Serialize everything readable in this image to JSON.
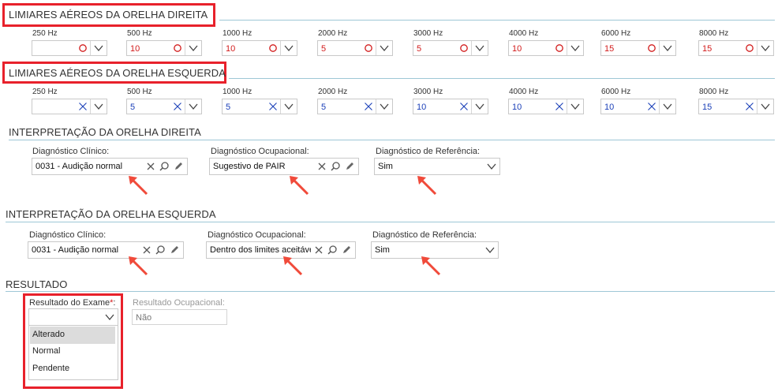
{
  "right_ear": {
    "title": "LIMIARES AÉREOS DA ORELHA DIREITA",
    "frequencies": [
      "250 Hz",
      "500 Hz",
      "1000 Hz",
      "2000 Hz",
      "3000 Hz",
      "4000 Hz",
      "6000 Hz",
      "8000 Hz"
    ],
    "values": [
      "",
      "10",
      "10",
      "5",
      "5",
      "10",
      "15",
      "15"
    ],
    "marker_icon": "circle-icon",
    "value_color": "#d21b1b"
  },
  "left_ear": {
    "title": "LIMIARES AÉREOS DA ORELHA ESQUERDA",
    "frequencies": [
      "250 Hz",
      "500 Hz",
      "1000 Hz",
      "2000 Hz",
      "3000 Hz",
      "4000 Hz",
      "6000 Hz",
      "8000 Hz"
    ],
    "values": [
      "",
      "5",
      "5",
      "5",
      "10",
      "10",
      "10",
      "15"
    ],
    "marker_icon": "x-mark-icon",
    "value_color": "#1a3fb8"
  },
  "interp_right": {
    "title": "INTERPRETAÇÃO DA ORELHA DIREITA",
    "clinical_label": "Diagnóstico Clínico:",
    "clinical_value": "0031 - Audição normal",
    "occupational_label": "Diagnóstico Ocupacional:",
    "occupational_value": "Sugestivo de PAIR",
    "reference_label": "Diagnóstico de Referência:",
    "reference_value": "Sim"
  },
  "interp_left": {
    "title": "INTERPRETAÇÃO DA ORELHA ESQUERDA",
    "clinical_label": "Diagnóstico Clínico:",
    "clinical_value": "0031 - Audição normal",
    "occupational_label": "Diagnóstico Ocupacional:",
    "occupational_value": "Dentro dos limites aceitáveis",
    "reference_label": "Diagnóstico de Referência:",
    "reference_value": "Sim"
  },
  "result": {
    "title": "RESULTADO",
    "exam_label": "Resultado do Exame",
    "required_mark": "*",
    "exam_colon": ":",
    "exam_value": "",
    "options": [
      "Alterado",
      "Normal",
      "Pendente"
    ],
    "occupational_label": "Resultado Ocupacional:",
    "occupational_value": "Não"
  },
  "colors": {
    "highlight_box": "#e8212b",
    "section_line": "#9ec7d6",
    "annotation_arrow": "#f04a3a"
  }
}
